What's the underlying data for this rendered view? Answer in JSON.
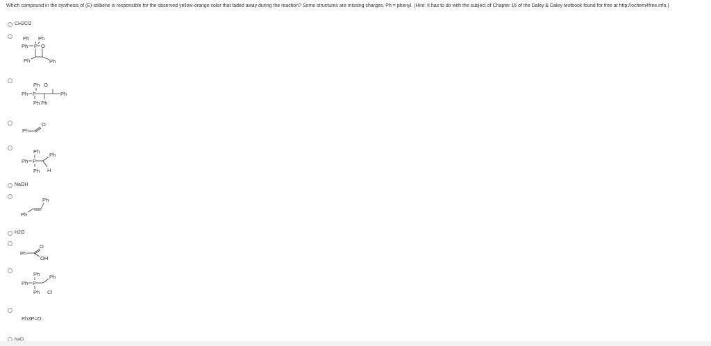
{
  "question": {
    "text": "Which compound in the synthesis of (E)-stilbene is responsible for the observed yellow-orange color that faded away during the reaction? Some structures are missing charges. Ph = phenyl. (Hint: It has to do with the subject of Chapter 16 of the Daley & Daley textbook found for free at http://ochem4free.info.)"
  },
  "options": [
    {
      "label": "CH2Cl2"
    },
    {
      "atoms": {
        "ph1": "Ph",
        "ph2": "Ph",
        "ph3": "Ph",
        "p": "P",
        "o": "O",
        "ph4": "Ph",
        "ph5": "Ph"
      }
    },
    {
      "atoms": {
        "ph1": "Ph",
        "o": "O",
        "ph2": "Ph",
        "p": "P",
        "ph3": "Ph",
        "ph4": "Ph Ph"
      }
    },
    {
      "atoms": {
        "ph": "Ph",
        "o": "O"
      }
    },
    {
      "atoms": {
        "ph1": "Ph",
        "ph2": "Ph",
        "ph3": "Ph",
        "p": "P",
        "ph4": "Ph",
        "h": "H"
      }
    },
    {
      "label": "NaOH"
    },
    {
      "atoms": {
        "ph1": "Ph",
        "ph2": "Ph"
      }
    },
    {
      "label": "H2O"
    },
    {
      "atoms": {
        "ph": "Ph",
        "o": "O",
        "oh": "OH"
      }
    },
    {
      "atoms": {
        "ph1": "Ph",
        "ph2": "Ph",
        "ph3": "Ph",
        "p": "P",
        "ph4": "Ph",
        "cl": "Cl"
      }
    },
    {
      "atoms": {
        "formula": "Ph3P=O"
      }
    },
    {
      "label": "NaCl"
    }
  ]
}
